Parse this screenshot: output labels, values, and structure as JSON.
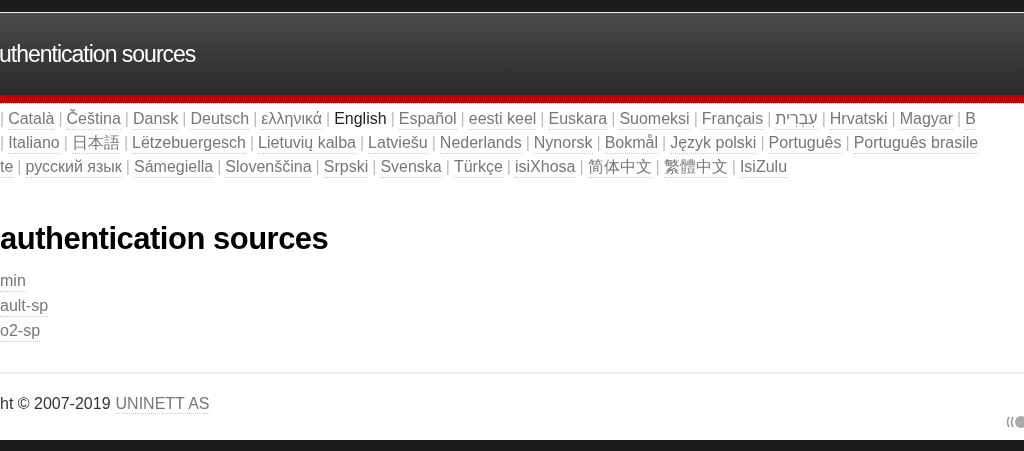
{
  "header": {
    "title": "uthentication sources"
  },
  "languages": {
    "separator": "|",
    "lines": [
      {
        "leading_separator": true,
        "items": [
          {
            "label": "Català",
            "selected": false
          },
          {
            "label": "Čeština",
            "selected": false
          },
          {
            "label": "Dansk",
            "selected": false
          },
          {
            "label": "Deutsch",
            "selected": false
          },
          {
            "label": "ελληνικά",
            "selected": false
          },
          {
            "label": "English",
            "selected": true
          },
          {
            "label": "Español",
            "selected": false
          },
          {
            "label": "eesti keel",
            "selected": false
          },
          {
            "label": "Euskara",
            "selected": false
          },
          {
            "label": "Suomeksi",
            "selected": false
          },
          {
            "label": "Français",
            "selected": false
          },
          {
            "label": "עִבְרִית",
            "selected": false
          },
          {
            "label": "Hrvatski",
            "selected": false
          },
          {
            "label": "Magyar",
            "selected": false
          },
          {
            "label": "B",
            "selected": false
          }
        ]
      },
      {
        "leading_separator": true,
        "items": [
          {
            "label": "Italiano",
            "selected": false
          },
          {
            "label": "日本語",
            "selected": false
          },
          {
            "label": "Lëtzebuergesch",
            "selected": false
          },
          {
            "label": "Lietuvių kalba",
            "selected": false
          },
          {
            "label": "Latviešu",
            "selected": false
          },
          {
            "label": "Nederlands",
            "selected": false
          },
          {
            "label": "Nynorsk",
            "selected": false
          },
          {
            "label": "Bokmål",
            "selected": false
          },
          {
            "label": "Język polski",
            "selected": false
          },
          {
            "label": "Português",
            "selected": false
          },
          {
            "label": "Português brasile",
            "selected": false
          }
        ]
      },
      {
        "leading_separator": false,
        "items": [
          {
            "label": "te",
            "selected": false
          },
          {
            "label": "русский язык",
            "selected": false
          },
          {
            "label": "Sámegiella",
            "selected": false
          },
          {
            "label": "Slovenščina",
            "selected": false
          },
          {
            "label": "Srpski",
            "selected": false
          },
          {
            "label": "Svenska",
            "selected": false
          },
          {
            "label": "Türkçe",
            "selected": false
          },
          {
            "label": "isiXhosa",
            "selected": false
          },
          {
            "label": "简体中文",
            "selected": false
          },
          {
            "label": "繁體中文",
            "selected": false
          },
          {
            "label": "IsiZulu",
            "selected": false
          }
        ]
      }
    ]
  },
  "heading": "authentication sources",
  "sources": [
    "min",
    "ault-sp",
    "o2-sp"
  ],
  "footer": {
    "copyright": "ht © 2007-2019",
    "link": "UNINETT AS"
  }
}
